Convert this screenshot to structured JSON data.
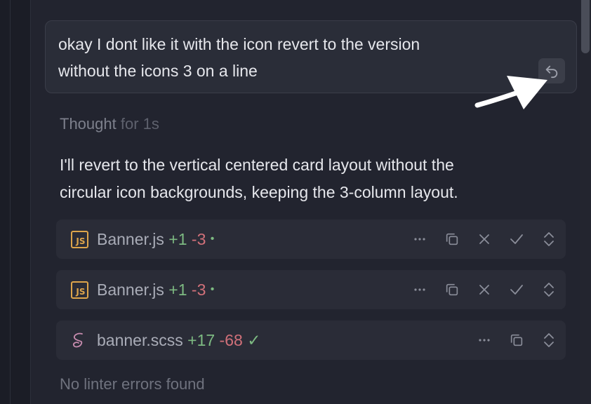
{
  "prompt": {
    "line1": "okay I dont like it with the icon revert to the version",
    "line2": "without the icons 3 on a line",
    "undo_icon": "undo-icon"
  },
  "thought": {
    "label": "Thought",
    "duration": "for 1s"
  },
  "reply": {
    "line1": "I'll revert to the vertical centered card layout without the",
    "line2": "circular icon backgrounds, keeping the 3-column layout."
  },
  "files": [
    {
      "icon": "js-file-icon",
      "badge": "JS",
      "name": "Banner.js",
      "added": "+1",
      "removed": "-3",
      "marker": "•",
      "marker_type": "dot"
    },
    {
      "icon": "js-file-icon",
      "badge": "JS",
      "name": "Banner.js",
      "added": "+1",
      "removed": "-3",
      "marker": "•",
      "marker_type": "dot"
    },
    {
      "icon": "sass-file-icon",
      "name": "banner.scss",
      "added": "+17",
      "removed": "-68",
      "marker": "✓",
      "marker_type": "check"
    }
  ],
  "status": {
    "text": "No linter errors found"
  },
  "colors": {
    "background": "#22242f",
    "added": "#7dba82",
    "removed": "#d07079",
    "js_badge": "#dea54b",
    "sass_icon": "#c98db0"
  }
}
